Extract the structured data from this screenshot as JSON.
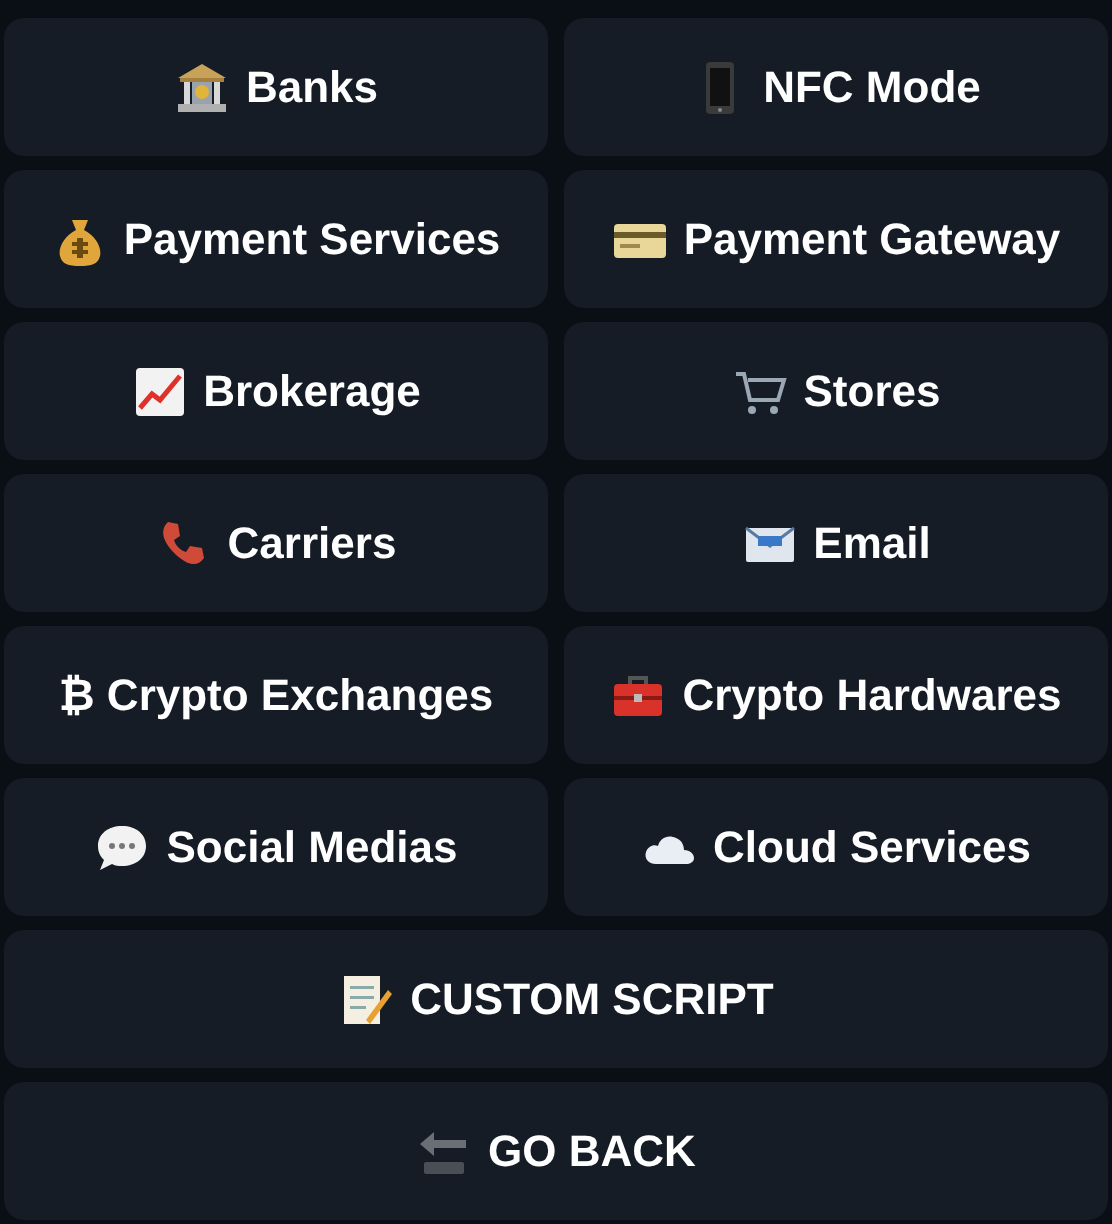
{
  "buttons": [
    {
      "label": "Banks",
      "kind": "bank",
      "wide": false
    },
    {
      "label": "NFC Mode",
      "kind": "phone",
      "wide": false
    },
    {
      "label": "Payment Services",
      "kind": "moneybag",
      "wide": false
    },
    {
      "label": "Payment Gateway",
      "kind": "card",
      "wide": false
    },
    {
      "label": "Brokerage",
      "kind": "chart",
      "wide": false
    },
    {
      "label": "Stores",
      "kind": "cart",
      "wide": false
    },
    {
      "label": "Carriers",
      "kind": "telephone",
      "wide": false
    },
    {
      "label": "Email",
      "kind": "envelope",
      "wide": false
    },
    {
      "label": "₿ Crypto Exchanges",
      "kind": "plain",
      "wide": false
    },
    {
      "label": "Crypto Hardwares",
      "kind": "toolbox",
      "wide": false
    },
    {
      "label": "Social Medias",
      "kind": "speech",
      "wide": false
    },
    {
      "label": "Cloud Services",
      "kind": "cloud",
      "wide": false
    },
    {
      "label": "CUSTOM SCRIPT",
      "kind": "memo",
      "wide": true
    },
    {
      "label": "GO BACK",
      "kind": "back",
      "wide": true
    }
  ]
}
